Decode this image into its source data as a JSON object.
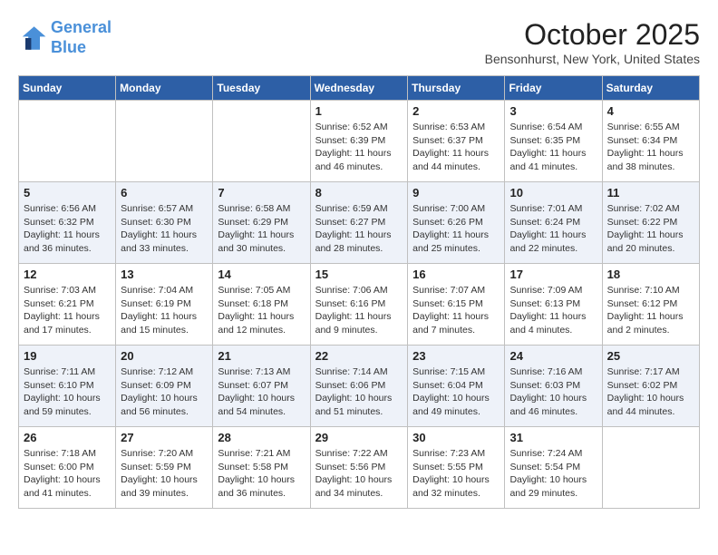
{
  "header": {
    "logo_line1": "General",
    "logo_line2": "Blue",
    "month_title": "October 2025",
    "location": "Bensonhurst, New York, United States"
  },
  "weekdays": [
    "Sunday",
    "Monday",
    "Tuesday",
    "Wednesday",
    "Thursday",
    "Friday",
    "Saturday"
  ],
  "weeks": [
    [
      {
        "day": "",
        "info": ""
      },
      {
        "day": "",
        "info": ""
      },
      {
        "day": "",
        "info": ""
      },
      {
        "day": "1",
        "info": "Sunrise: 6:52 AM\nSunset: 6:39 PM\nDaylight: 11 hours and 46 minutes."
      },
      {
        "day": "2",
        "info": "Sunrise: 6:53 AM\nSunset: 6:37 PM\nDaylight: 11 hours and 44 minutes."
      },
      {
        "day": "3",
        "info": "Sunrise: 6:54 AM\nSunset: 6:35 PM\nDaylight: 11 hours and 41 minutes."
      },
      {
        "day": "4",
        "info": "Sunrise: 6:55 AM\nSunset: 6:34 PM\nDaylight: 11 hours and 38 minutes."
      }
    ],
    [
      {
        "day": "5",
        "info": "Sunrise: 6:56 AM\nSunset: 6:32 PM\nDaylight: 11 hours and 36 minutes."
      },
      {
        "day": "6",
        "info": "Sunrise: 6:57 AM\nSunset: 6:30 PM\nDaylight: 11 hours and 33 minutes."
      },
      {
        "day": "7",
        "info": "Sunrise: 6:58 AM\nSunset: 6:29 PM\nDaylight: 11 hours and 30 minutes."
      },
      {
        "day": "8",
        "info": "Sunrise: 6:59 AM\nSunset: 6:27 PM\nDaylight: 11 hours and 28 minutes."
      },
      {
        "day": "9",
        "info": "Sunrise: 7:00 AM\nSunset: 6:26 PM\nDaylight: 11 hours and 25 minutes."
      },
      {
        "day": "10",
        "info": "Sunrise: 7:01 AM\nSunset: 6:24 PM\nDaylight: 11 hours and 22 minutes."
      },
      {
        "day": "11",
        "info": "Sunrise: 7:02 AM\nSunset: 6:22 PM\nDaylight: 11 hours and 20 minutes."
      }
    ],
    [
      {
        "day": "12",
        "info": "Sunrise: 7:03 AM\nSunset: 6:21 PM\nDaylight: 11 hours and 17 minutes."
      },
      {
        "day": "13",
        "info": "Sunrise: 7:04 AM\nSunset: 6:19 PM\nDaylight: 11 hours and 15 minutes."
      },
      {
        "day": "14",
        "info": "Sunrise: 7:05 AM\nSunset: 6:18 PM\nDaylight: 11 hours and 12 minutes."
      },
      {
        "day": "15",
        "info": "Sunrise: 7:06 AM\nSunset: 6:16 PM\nDaylight: 11 hours and 9 minutes."
      },
      {
        "day": "16",
        "info": "Sunrise: 7:07 AM\nSunset: 6:15 PM\nDaylight: 11 hours and 7 minutes."
      },
      {
        "day": "17",
        "info": "Sunrise: 7:09 AM\nSunset: 6:13 PM\nDaylight: 11 hours and 4 minutes."
      },
      {
        "day": "18",
        "info": "Sunrise: 7:10 AM\nSunset: 6:12 PM\nDaylight: 11 hours and 2 minutes."
      }
    ],
    [
      {
        "day": "19",
        "info": "Sunrise: 7:11 AM\nSunset: 6:10 PM\nDaylight: 10 hours and 59 minutes."
      },
      {
        "day": "20",
        "info": "Sunrise: 7:12 AM\nSunset: 6:09 PM\nDaylight: 10 hours and 56 minutes."
      },
      {
        "day": "21",
        "info": "Sunrise: 7:13 AM\nSunset: 6:07 PM\nDaylight: 10 hours and 54 minutes."
      },
      {
        "day": "22",
        "info": "Sunrise: 7:14 AM\nSunset: 6:06 PM\nDaylight: 10 hours and 51 minutes."
      },
      {
        "day": "23",
        "info": "Sunrise: 7:15 AM\nSunset: 6:04 PM\nDaylight: 10 hours and 49 minutes."
      },
      {
        "day": "24",
        "info": "Sunrise: 7:16 AM\nSunset: 6:03 PM\nDaylight: 10 hours and 46 minutes."
      },
      {
        "day": "25",
        "info": "Sunrise: 7:17 AM\nSunset: 6:02 PM\nDaylight: 10 hours and 44 minutes."
      }
    ],
    [
      {
        "day": "26",
        "info": "Sunrise: 7:18 AM\nSunset: 6:00 PM\nDaylight: 10 hours and 41 minutes."
      },
      {
        "day": "27",
        "info": "Sunrise: 7:20 AM\nSunset: 5:59 PM\nDaylight: 10 hours and 39 minutes."
      },
      {
        "day": "28",
        "info": "Sunrise: 7:21 AM\nSunset: 5:58 PM\nDaylight: 10 hours and 36 minutes."
      },
      {
        "day": "29",
        "info": "Sunrise: 7:22 AM\nSunset: 5:56 PM\nDaylight: 10 hours and 34 minutes."
      },
      {
        "day": "30",
        "info": "Sunrise: 7:23 AM\nSunset: 5:55 PM\nDaylight: 10 hours and 32 minutes."
      },
      {
        "day": "31",
        "info": "Sunrise: 7:24 AM\nSunset: 5:54 PM\nDaylight: 10 hours and 29 minutes."
      },
      {
        "day": "",
        "info": ""
      }
    ]
  ]
}
